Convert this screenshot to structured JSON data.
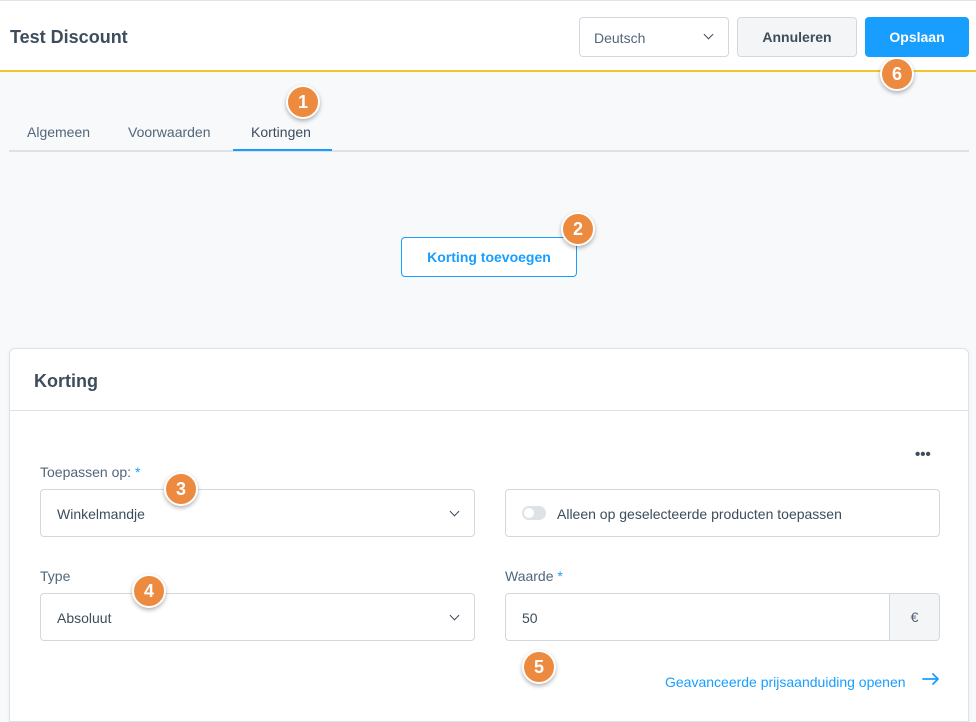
{
  "header": {
    "title": "Test Discount",
    "language_select": "Deutsch",
    "cancel_label": "Annuleren",
    "save_label": "Opslaan"
  },
  "tabs": [
    {
      "label": "Algemeen"
    },
    {
      "label": "Voorwaarden"
    },
    {
      "label": "Kortingen",
      "active": true
    }
  ],
  "add_discount_label": "Korting toevoegen",
  "card": {
    "title": "Korting",
    "more_icon": "•••",
    "apply_on": {
      "label": "Toepassen op:",
      "required": "*",
      "value": "Winkelmandje"
    },
    "toggle": {
      "label": "Alleen op geselecteerde producten toepassen",
      "on": false
    },
    "type": {
      "label": "Type",
      "value": "Absoluut"
    },
    "value": {
      "label": "Waarde",
      "required": "*",
      "value": "50",
      "suffix": "€"
    },
    "advanced_link": "Geavanceerde prijsaanduiding openen"
  },
  "badges": [
    "1",
    "2",
    "3",
    "4",
    "5",
    "6"
  ],
  "colors": {
    "accent": "#189eff",
    "header_border": "#f2c530",
    "badge": "#ec8a3f"
  }
}
